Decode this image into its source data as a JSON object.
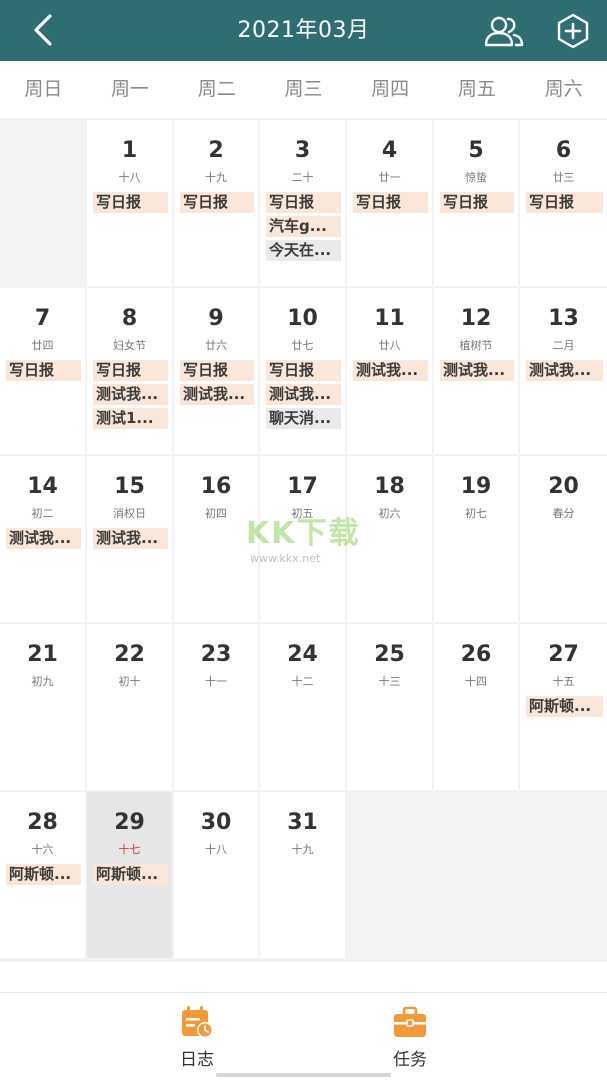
{
  "header": {
    "title": "2021年03月",
    "icons": {
      "back": "chevron-left-icon",
      "share": "users-icon",
      "add": "plus-circle-icon"
    }
  },
  "weekdays": [
    "周日",
    "周一",
    "周二",
    "周三",
    "周四",
    "周五",
    "周六"
  ],
  "weeks": [
    [
      null,
      {
        "day": "1",
        "lunar": "十八",
        "events": [
          {
            "t": "写日报"
          }
        ]
      },
      {
        "day": "2",
        "lunar": "十九",
        "events": [
          {
            "t": "写日报"
          }
        ]
      },
      {
        "day": "3",
        "lunar": "二十",
        "events": [
          {
            "t": "写日报"
          },
          {
            "t": "汽车g..."
          },
          {
            "t": "今天在...",
            "grey": true
          }
        ]
      },
      {
        "day": "4",
        "lunar": "廿一",
        "events": [
          {
            "t": "写日报"
          }
        ]
      },
      {
        "day": "5",
        "lunar": "惊蛰",
        "events": [
          {
            "t": "写日报"
          }
        ]
      },
      {
        "day": "6",
        "lunar": "廿三",
        "events": [
          {
            "t": "写日报"
          }
        ]
      }
    ],
    [
      {
        "day": "7",
        "lunar": "廿四",
        "events": [
          {
            "t": "写日报"
          }
        ]
      },
      {
        "day": "8",
        "lunar": "妇女节",
        "events": [
          {
            "t": "写日报"
          },
          {
            "t": "测试我..."
          },
          {
            "t": "测试1..."
          }
        ]
      },
      {
        "day": "9",
        "lunar": "廿六",
        "events": [
          {
            "t": "写日报"
          },
          {
            "t": "测试我..."
          }
        ]
      },
      {
        "day": "10",
        "lunar": "廿七",
        "events": [
          {
            "t": "写日报"
          },
          {
            "t": "测试我..."
          },
          {
            "t": "聊天消...",
            "grey": true
          }
        ]
      },
      {
        "day": "11",
        "lunar": "廿八",
        "events": [
          {
            "t": "测试我..."
          }
        ]
      },
      {
        "day": "12",
        "lunar": "植树节",
        "events": [
          {
            "t": "测试我..."
          }
        ]
      },
      {
        "day": "13",
        "lunar": "二月",
        "events": [
          {
            "t": "测试我..."
          }
        ]
      }
    ],
    [
      {
        "day": "14",
        "lunar": "初二",
        "events": [
          {
            "t": "测试我..."
          }
        ]
      },
      {
        "day": "15",
        "lunar": "消权日",
        "events": [
          {
            "t": "测试我..."
          }
        ]
      },
      {
        "day": "16",
        "lunar": "初四",
        "events": []
      },
      {
        "day": "17",
        "lunar": "初五",
        "events": []
      },
      {
        "day": "18",
        "lunar": "初六",
        "events": []
      },
      {
        "day": "19",
        "lunar": "初七",
        "events": []
      },
      {
        "day": "20",
        "lunar": "春分",
        "events": []
      }
    ],
    [
      {
        "day": "21",
        "lunar": "初九",
        "events": []
      },
      {
        "day": "22",
        "lunar": "初十",
        "events": []
      },
      {
        "day": "23",
        "lunar": "十一",
        "events": []
      },
      {
        "day": "24",
        "lunar": "十二",
        "events": []
      },
      {
        "day": "25",
        "lunar": "十三",
        "events": []
      },
      {
        "day": "26",
        "lunar": "十四",
        "events": []
      },
      {
        "day": "27",
        "lunar": "十五",
        "events": [
          {
            "t": "阿斯顿..."
          }
        ]
      }
    ],
    [
      {
        "day": "28",
        "lunar": "十六",
        "events": [
          {
            "t": "阿斯顿..."
          }
        ]
      },
      {
        "day": "29",
        "lunar": "十七",
        "lunarRed": true,
        "selected": true,
        "events": [
          {
            "t": "阿斯顿..."
          }
        ]
      },
      {
        "day": "30",
        "lunar": "十八",
        "events": []
      },
      {
        "day": "31",
        "lunar": "十九",
        "events": []
      },
      null,
      null,
      null
    ]
  ],
  "watermark": {
    "brand": "KK下载",
    "url": "www.kkx.net"
  },
  "tabbar": {
    "items": [
      {
        "label": "日志",
        "icon": "calendar-clock-icon"
      },
      {
        "label": "任务",
        "icon": "briefcase-icon"
      }
    ]
  },
  "colors": {
    "header_bg": "#2e6e73",
    "accent_orange": "#f29a3a",
    "event_bg": "#fbe7d9"
  }
}
